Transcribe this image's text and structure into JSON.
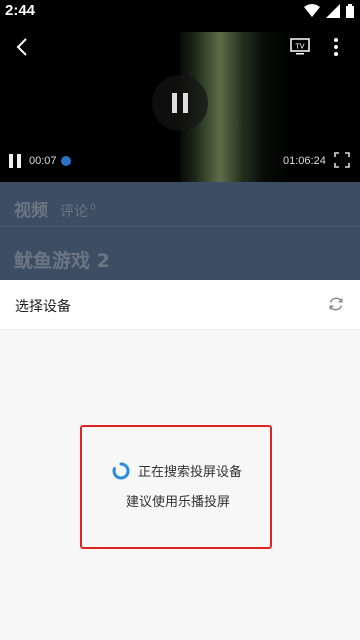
{
  "status_bar": {
    "time": "2:44"
  },
  "player": {
    "current_time": "00:07",
    "total_time": "01:06:24",
    "progress_fraction": 0.002
  },
  "info": {
    "tabs": {
      "video": "视频",
      "comment": "评论",
      "comment_count": "0"
    },
    "title": "鱿鱼游戏 2"
  },
  "sheet": {
    "title": "选择设备",
    "searching_text": "正在搜索投屏设备",
    "suggestion_text": "建议使用乐播投屏"
  },
  "colors": {
    "accent": "#2a72c8",
    "highlight_border": "#e02424",
    "spinner": "#2a8be0"
  },
  "icons": [
    "back-arrow-icon",
    "tv-cast-icon",
    "more-vertical-icon",
    "pause-icon",
    "fullscreen-icon",
    "refresh-icon",
    "loading-spinner-icon",
    "wifi-icon",
    "signal-icon",
    "battery-icon"
  ]
}
